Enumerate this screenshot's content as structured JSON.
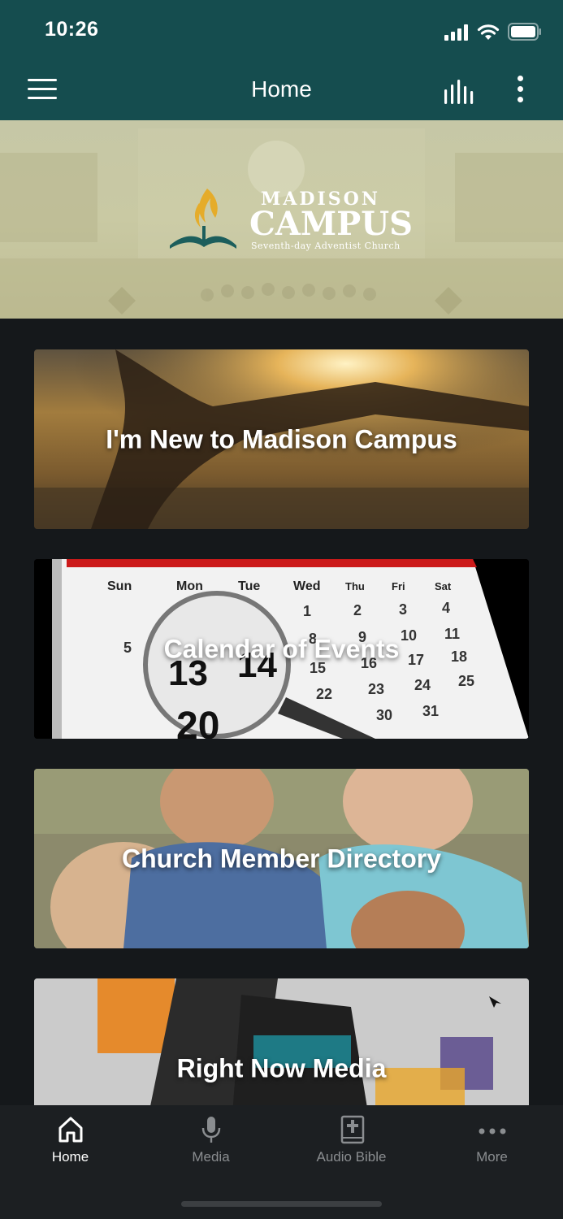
{
  "status_bar": {
    "time": "10:26"
  },
  "app_bar": {
    "title": "Home"
  },
  "banner": {
    "logo_line1": "MADISON",
    "logo_line2": "CAMPUS",
    "logo_tagline": "Seventh-day Adventist Church"
  },
  "cards": [
    {
      "title": "I'm New to Madison Campus"
    },
    {
      "title": "Calendar of Events"
    },
    {
      "title": "Church Member Directory"
    },
    {
      "title": "Right Now Media"
    }
  ],
  "calendar_art": {
    "days": [
      "Sun",
      "Mon",
      "Tue",
      "Wed",
      "Thu",
      "Fri",
      "Sat"
    ]
  },
  "tab_bar": {
    "tabs": [
      {
        "label": "Home",
        "icon": "home-icon",
        "active": true
      },
      {
        "label": "Media",
        "icon": "microphone-icon",
        "active": false
      },
      {
        "label": "Audio Bible",
        "icon": "bible-icon",
        "active": false
      },
      {
        "label": "More",
        "icon": "more-icon",
        "active": false
      }
    ]
  },
  "colors": {
    "header": "#154d4f",
    "background": "#15181b",
    "tab_bar": "#1c1f22",
    "tab_inactive": "#8a8d90"
  }
}
